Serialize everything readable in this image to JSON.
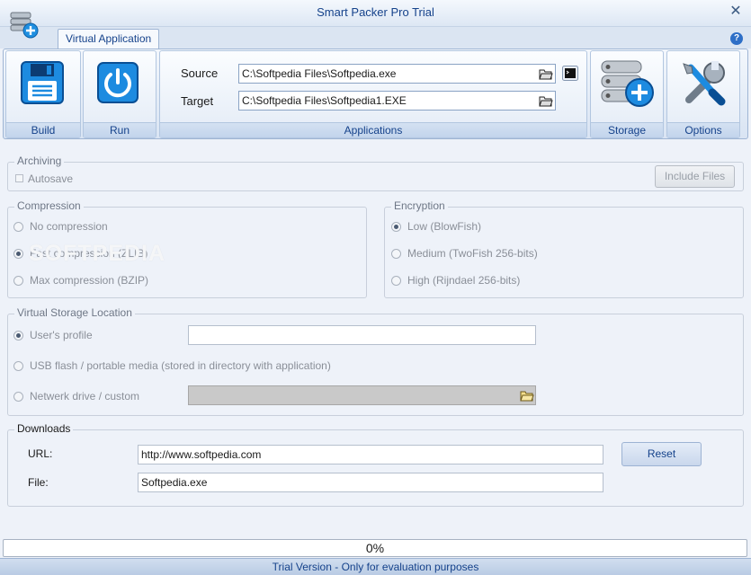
{
  "window": {
    "title": "Smart Packer Pro Trial",
    "close_glyph": "✕"
  },
  "ribbon": {
    "tab": "Virtual Application",
    "help_glyph": "?",
    "build_label": "Build",
    "run_label": "Run",
    "applications_label": "Applications",
    "storage_label": "Storage",
    "options_label": "Options",
    "source_label": "Source",
    "source_value": "C:\\Softpedia Files\\Softpedia.exe",
    "target_label": "Target",
    "target_value": "C:\\Softpedia Files\\Softpedia1.EXE"
  },
  "archiving": {
    "title": "Archiving",
    "autosave_label": "Autosave",
    "include_files_label": "Include Files"
  },
  "compression": {
    "title": "Compression",
    "options": [
      "No compression",
      "Fast compression (ZLIB)",
      "Max compression (BZIP)"
    ],
    "selected": 1
  },
  "encryption": {
    "title": "Encryption",
    "options": [
      "Low (BlowFish)",
      "Medium (TwoFish 256-bits)",
      "High (Rijndael 256-bits)"
    ],
    "selected": 0
  },
  "storage_location": {
    "title": "Virtual Storage Location",
    "users_profile": "User's profile",
    "usb": "USB flash / portable media (stored in directory with application)",
    "network": "Netwerk drive / custom",
    "users_profile_value": "",
    "network_value": ""
  },
  "downloads": {
    "title": "Downloads",
    "url_label": "URL:",
    "url_value": "http://www.softpedia.com",
    "file_label": "File:",
    "file_value": "Softpedia.exe",
    "reset_label": "Reset"
  },
  "watermark": "SOFTPEDIA",
  "progress": "0%",
  "status": "Trial Version - Only for evaluation purposes",
  "colors": {
    "accent": "#15428b",
    "ribbon": "#dbe5f2",
    "background": "#eef2f9"
  }
}
